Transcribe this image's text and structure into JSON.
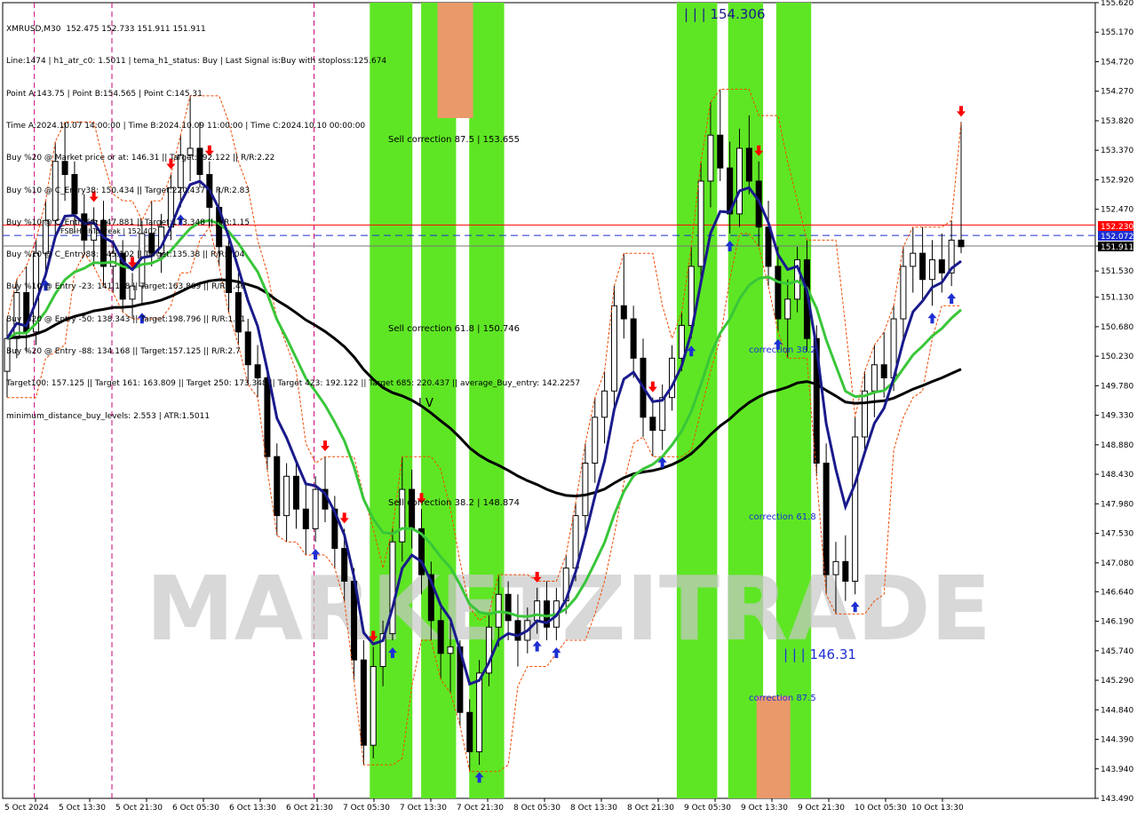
{
  "window": {
    "symbol_header": "XMRUSD,M30  152.475 152.733 151.911 151.911"
  },
  "info_panel": {
    "lines": [
      "Line:1474 | h1_atr_c0: 1.5011 | tema_h1_status: Buy | Last Signal is:Buy with stoploss:125.674",
      "Point A:143.75 | Point B:154.565 | Point C:145.31",
      "Time A:2024.10.07 14:00:00 | Time B:2024.10.09 11:00:00 | Time C:2024.10.10 00:00:00",
      "Buy %20 @ Market price or at: 146.31 || Target:192.122 || R/R:2.22",
      "Buy %10 @ C_Entry38: 150.434 || Target:220.437 || R/R:2.83",
      "Buy %10 @ C_Entry61: 147.881 || Target:173.348 || R/R:1.15",
      "Buy %10 @ C_Entry88: 145.102 || Target:135.38 || R/R:1.04",
      "Buy %10 @ Entry -23: 141.198 || Target:163.809 || R/R:1.46",
      "Buy %20 @ Entry -50: 138.343 || Target:198.796 || R/R:1.61",
      "Buy %20 @ Entry -88: 134.168 || Target:157.125 || R/R:2.7",
      "Target100: 157.125 || Target 161: 163.809 || Target 250: 173.348 || Target 423: 192.122 || Target 685: 220.437 || average_Buy_entry: 142.2257",
      "minimum_distance_buy_levels: 2.553 | ATR:1.5011"
    ]
  },
  "labels": {
    "high_label": "| | | 154.306",
    "low_label": "| | | 146.31",
    "wave_label": "I V",
    "sell_corr_875": "Sell correction 87.5 | 153.655",
    "sell_corr_618": "Sell correction 61.8 | 150.746",
    "sell_corr_382": "Sell correction 38.2 | 148.874",
    "corr_382": "correction 38.2",
    "corr_618": "correction 61.8",
    "corr_875": "correction 87.5",
    "break_label": "FSB-HighToBreak | 152.402",
    "watermark": "MARKETZITRADE"
  },
  "price_tags": {
    "red": "152.230",
    "blue": "152.072",
    "current": "151.911"
  },
  "colors": {
    "bull_zone": "#5ee624",
    "bear_zone": "#e9996a",
    "price_red": "#ff0000",
    "price_blue": "#1d2fd3",
    "tema": "#1a1a8c",
    "ma_green": "#39c639",
    "ma_black": "#000000",
    "channel": "#f04a00"
  },
  "chart_data": {
    "type": "candlestick",
    "title": "XMRUSD,M30",
    "ylim": [
      143.49,
      155.62
    ],
    "y_ticks": [
      "155.620",
      "155.170",
      "154.720",
      "154.270",
      "153.820",
      "153.370",
      "152.920",
      "152.470",
      "151.910",
      "151.530",
      "151.130",
      "150.680",
      "150.230",
      "149.780",
      "149.330",
      "148.880",
      "148.430",
      "147.980",
      "147.530",
      "147.080",
      "146.640",
      "146.190",
      "145.740",
      "145.290",
      "144.840",
      "144.390",
      "143.940",
      "143.490"
    ],
    "x_ticks": [
      "5 Oct 2024",
      "5 Oct 13:30",
      "5 Oct 21:30",
      "6 Oct 05:30",
      "6 Oct 13:30",
      "6 Oct 21:30",
      "7 Oct 05:30",
      "7 Oct 13:30",
      "7 Oct 21:30",
      "8 Oct 05:30",
      "8 Oct 13:30",
      "8 Oct 21:30",
      "9 Oct 05:30",
      "9 Oct 13:30",
      "9 Oct 21:30",
      "10 Oct 05:30",
      "10 Oct 13:30"
    ],
    "ohlc": [
      [
        150.0,
        150.8,
        149.6,
        150.5
      ],
      [
        150.5,
        151.4,
        150.2,
        151.2
      ],
      [
        151.2,
        151.6,
        150.3,
        150.6
      ],
      [
        150.6,
        152.0,
        150.4,
        151.8
      ],
      [
        151.8,
        152.6,
        151.5,
        152.3
      ],
      [
        152.3,
        153.5,
        152.0,
        153.2
      ],
      [
        153.2,
        153.8,
        152.6,
        153.0
      ],
      [
        153.0,
        153.2,
        152.1,
        152.4
      ],
      [
        152.4,
        152.7,
        151.8,
        152.0
      ],
      [
        152.0,
        152.5,
        151.6,
        152.3
      ],
      [
        152.3,
        152.6,
        151.3,
        151.6
      ],
      [
        151.6,
        152.0,
        151.2,
        151.8
      ],
      [
        151.8,
        152.0,
        150.9,
        151.1
      ],
      [
        151.1,
        151.5,
        150.8,
        151.3
      ],
      [
        151.3,
        152.3,
        151.0,
        152.1
      ],
      [
        152.1,
        152.6,
        151.6,
        151.8
      ],
      [
        151.8,
        152.4,
        151.5,
        152.2
      ],
      [
        152.2,
        153.0,
        152.0,
        152.8
      ],
      [
        152.8,
        153.6,
        152.5,
        153.3
      ],
      [
        153.3,
        154.2,
        152.9,
        153.4
      ],
      [
        153.4,
        153.8,
        152.8,
        153.0
      ],
      [
        153.0,
        153.2,
        152.2,
        152.5
      ],
      [
        152.5,
        152.8,
        151.6,
        151.9
      ],
      [
        151.9,
        152.0,
        150.9,
        151.2
      ],
      [
        151.2,
        151.5,
        150.4,
        150.6
      ],
      [
        150.6,
        150.8,
        149.8,
        150.1
      ],
      [
        150.1,
        150.4,
        149.6,
        149.9
      ],
      [
        149.9,
        150.0,
        148.5,
        148.7
      ],
      [
        148.7,
        148.9,
        147.5,
        147.8
      ],
      [
        147.8,
        148.6,
        147.4,
        148.4
      ],
      [
        148.4,
        148.6,
        147.6,
        147.9
      ],
      [
        147.9,
        148.3,
        147.2,
        147.6
      ],
      [
        147.6,
        148.4,
        147.4,
        148.2
      ],
      [
        148.2,
        148.7,
        147.7,
        147.9
      ],
      [
        147.9,
        148.1,
        147.0,
        147.3
      ],
      [
        147.3,
        147.6,
        146.5,
        146.8
      ],
      [
        146.8,
        147.0,
        145.3,
        145.6
      ],
      [
        145.6,
        145.9,
        144.0,
        144.3
      ],
      [
        144.3,
        145.8,
        144.1,
        145.5
      ],
      [
        145.5,
        146.2,
        145.2,
        146.0
      ],
      [
        146.0,
        147.6,
        145.9,
        147.4
      ],
      [
        147.4,
        148.7,
        147.1,
        148.2
      ],
      [
        148.2,
        148.5,
        147.3,
        147.6
      ],
      [
        147.6,
        147.9,
        146.6,
        146.9
      ],
      [
        146.9,
        147.1,
        145.9,
        146.2
      ],
      [
        146.2,
        146.4,
        145.3,
        145.7
      ],
      [
        145.7,
        146.2,
        145.1,
        145.8
      ],
      [
        145.8,
        145.9,
        144.6,
        144.8
      ],
      [
        144.8,
        145.0,
        143.9,
        144.2
      ],
      [
        144.2,
        145.6,
        144.0,
        145.4
      ],
      [
        145.4,
        146.3,
        145.2,
        146.1
      ],
      [
        146.1,
        146.9,
        145.8,
        146.6
      ],
      [
        146.6,
        146.8,
        145.9,
        146.2
      ],
      [
        146.2,
        146.6,
        145.5,
        145.9
      ],
      [
        145.9,
        146.4,
        145.7,
        146.2
      ],
      [
        146.2,
        146.7,
        146.0,
        146.5
      ],
      [
        146.5,
        146.8,
        145.9,
        146.1
      ],
      [
        146.1,
        146.7,
        145.9,
        146.5
      ],
      [
        146.5,
        147.2,
        146.3,
        147.0
      ],
      [
        147.0,
        148.0,
        146.8,
        147.8
      ],
      [
        147.8,
        148.9,
        147.5,
        148.6
      ],
      [
        148.6,
        149.6,
        148.3,
        149.3
      ],
      [
        149.3,
        150.0,
        148.9,
        149.7
      ],
      [
        149.7,
        151.3,
        149.4,
        151.0
      ],
      [
        151.0,
        151.8,
        150.5,
        150.8
      ],
      [
        150.8,
        151.0,
        149.9,
        150.2
      ],
      [
        150.2,
        150.5,
        149.0,
        149.3
      ],
      [
        149.3,
        149.6,
        148.7,
        149.1
      ],
      [
        149.1,
        149.8,
        148.8,
        149.6
      ],
      [
        149.6,
        150.4,
        149.4,
        150.2
      ],
      [
        150.2,
        150.9,
        150.0,
        150.7
      ],
      [
        150.7,
        151.9,
        150.5,
        151.6
      ],
      [
        151.6,
        153.2,
        151.4,
        152.9
      ],
      [
        152.9,
        154.1,
        152.5,
        153.6
      ],
      [
        153.6,
        154.3,
        152.9,
        153.1
      ],
      [
        153.1,
        153.5,
        152.1,
        152.4
      ],
      [
        152.4,
        153.7,
        152.2,
        153.4
      ],
      [
        153.4,
        153.9,
        152.7,
        152.9
      ],
      [
        152.9,
        153.2,
        151.9,
        152.2
      ],
      [
        152.2,
        152.6,
        151.3,
        151.6
      ],
      [
        151.6,
        151.9,
        150.6,
        150.8
      ],
      [
        150.8,
        151.4,
        150.2,
        151.1
      ],
      [
        151.1,
        151.9,
        150.9,
        151.7
      ],
      [
        151.7,
        152.0,
        150.3,
        150.5
      ],
      [
        150.5,
        150.7,
        148.4,
        148.6
      ],
      [
        148.6,
        148.9,
        146.6,
        146.9
      ],
      [
        146.9,
        147.4,
        146.3,
        147.1
      ],
      [
        147.1,
        147.5,
        146.5,
        146.8
      ],
      [
        146.8,
        149.3,
        146.6,
        149.0
      ],
      [
        149.0,
        150.0,
        148.8,
        149.7
      ],
      [
        149.7,
        150.4,
        149.3,
        150.1
      ],
      [
        150.1,
        150.6,
        149.6,
        149.9
      ],
      [
        149.9,
        151.0,
        149.7,
        150.8
      ],
      [
        150.8,
        151.9,
        150.5,
        151.6
      ],
      [
        151.6,
        152.2,
        151.2,
        151.8
      ],
      [
        151.8,
        152.2,
        151.1,
        151.4
      ],
      [
        151.4,
        152.0,
        151.0,
        151.7
      ],
      [
        151.7,
        152.1,
        151.2,
        151.5
      ],
      [
        151.5,
        152.3,
        151.3,
        152.0
      ],
      [
        152.0,
        153.8,
        151.8,
        151.9
      ]
    ],
    "zones": [
      {
        "kind": "bull",
        "x0": 0.336,
        "x1": 0.375
      },
      {
        "kind": "bull",
        "x0": 0.383,
        "x1": 0.415
      },
      {
        "kind": "bull",
        "x0": 0.427,
        "x1": 0.459
      },
      {
        "kind": "bull",
        "x0": 0.617,
        "x1": 0.654
      },
      {
        "kind": "bull",
        "x0": 0.664,
        "x1": 0.696
      },
      {
        "kind": "bull",
        "x0": 0.708,
        "x1": 0.74
      }
    ]
  }
}
